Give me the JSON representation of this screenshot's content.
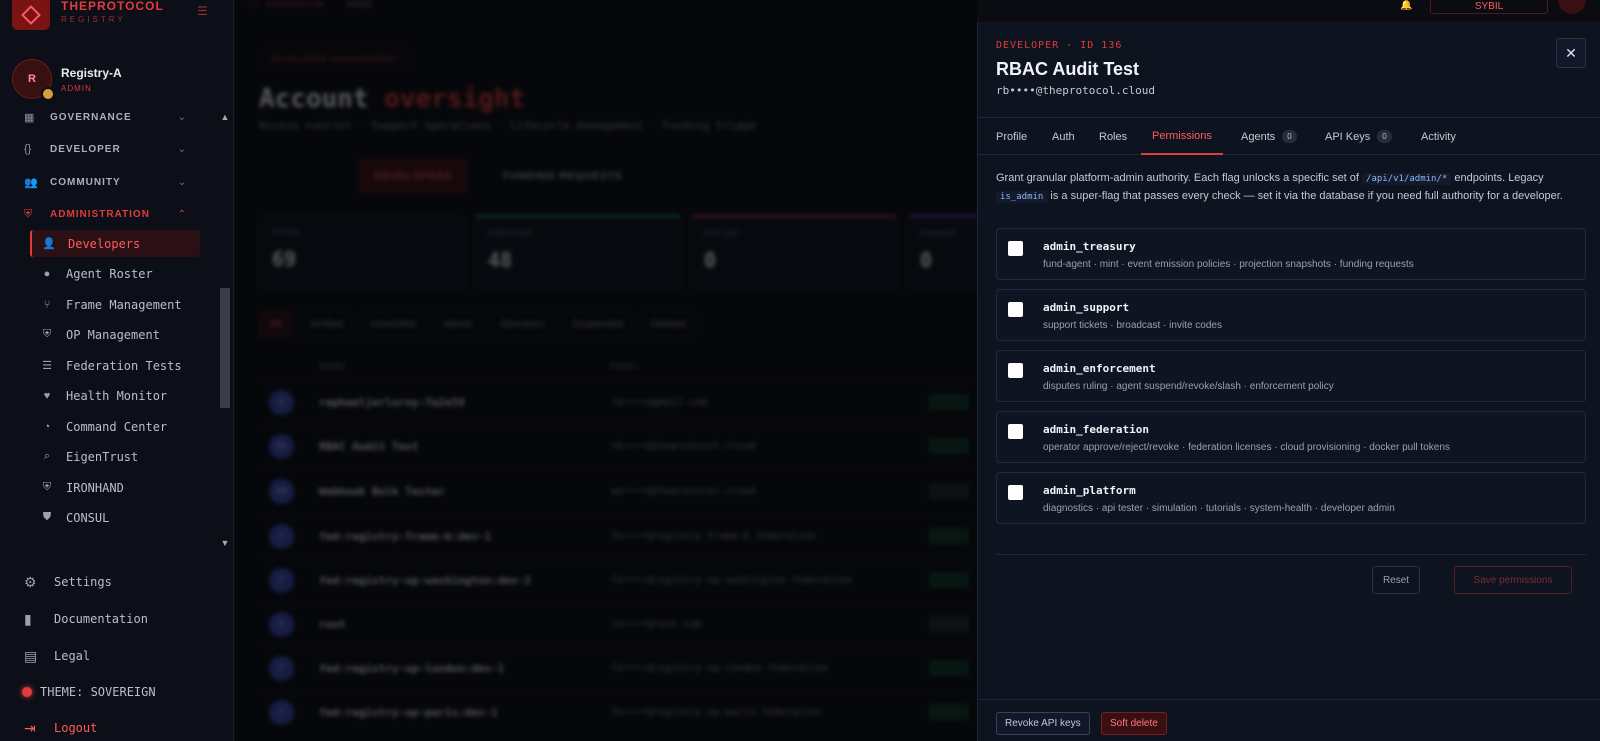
{
  "brand": {
    "name": "THEPROTOCOL",
    "sub": "REGISTRY"
  },
  "user": {
    "name": "Registry-A",
    "role": "ADMIN",
    "initial": "R"
  },
  "nav": {
    "groups": [
      {
        "label": "GOVERNANCE",
        "icon": "grid-icon"
      },
      {
        "label": "DEVELOPER",
        "icon": "code-braces-icon"
      },
      {
        "label": "COMMUNITY",
        "icon": "people-icon"
      },
      {
        "label": "ADMINISTRATION",
        "icon": "shield-icon"
      }
    ],
    "items": [
      {
        "label": "Developers"
      },
      {
        "label": "Agent Roster"
      },
      {
        "label": "Frame Management"
      },
      {
        "label": "OP Management"
      },
      {
        "label": "Federation Tests"
      },
      {
        "label": "Health Monitor"
      },
      {
        "label": "Command Center"
      },
      {
        "label": "EigenTrust"
      },
      {
        "label": "IRONHAND"
      },
      {
        "label": "CONSUL"
      }
    ],
    "footer": {
      "settings": "Settings",
      "documentation": "Documentation",
      "legal": "Legal",
      "theme": "THEME: SOVEREIGN",
      "logout": "Logout"
    }
  },
  "main": {
    "breadcrumb": "// SOVEREIGN",
    "breadcrumb2": "NODE",
    "pill": "DEVELOPER MANAGEMENT",
    "title_a": "Account",
    "title_b": "oversight",
    "subtitle": "Access control · Support operations · Lifecycle management · Funding triage",
    "tabs": [
      "DEVELOPERS",
      "FUNDING REQUESTS"
    ],
    "stats": [
      {
        "label": "TOTAL",
        "value": "69"
      },
      {
        "label": "VERIFIED",
        "value": "48"
      },
      {
        "label": "2FA ON",
        "value": "0"
      },
      {
        "label": "ADMINS",
        "value": "0"
      }
    ],
    "filters": [
      "All",
      "Verified",
      "Unverified",
      "Admin",
      "Operators",
      "Suspended",
      "Deleted"
    ],
    "columns": [
      "NAME",
      "EMAIL"
    ],
    "rows": [
      {
        "initials": "R",
        "name": "raphaeljerlorny-7a2e59",
        "email": "ra••••@gmail.com"
      },
      {
        "initials": "RA",
        "name": "RBAC Audit Test",
        "email": "rb••••@theprotocol.cloud"
      },
      {
        "initials": "WB",
        "name": "Webhook Bulk Tester",
        "email": "we••••@theprotocol.cloud"
      },
      {
        "initials": "F",
        "name": "fed:registry-frame-b:dev-1",
        "email": "fe••••@registry-frame-b.federation"
      },
      {
        "initials": "F",
        "name": "fed:registry-op-washington:dev-2",
        "email": "fe••••@registry-op-washington.federation"
      },
      {
        "initials": "R",
        "name": "root",
        "email": "ro••••@root.com"
      },
      {
        "initials": "F",
        "name": "fed:registry-op-london:dev-1",
        "email": "fe••••@registry-op-london.federation"
      },
      {
        "initials": "F",
        "name": "fed:registry-op-paris:dev-1",
        "email": "fe••••@registry-op-paris.federation"
      }
    ]
  },
  "drawer": {
    "kicker": "DEVELOPER · ID 136",
    "title": "RBAC Audit Test",
    "email": "rb••••@theprotocol.cloud",
    "close": "✕",
    "tabs": [
      {
        "label": "Profile"
      },
      {
        "label": "Auth"
      },
      {
        "label": "Roles"
      },
      {
        "label": "Permissions"
      },
      {
        "label": "Agents",
        "count": "0"
      },
      {
        "label": "API Keys",
        "count": "0"
      },
      {
        "label": "Activity"
      }
    ],
    "desc_1": "Grant granular platform-admin authority. Each flag unlocks a specific set of",
    "desc_code1": "/api/v1/admin/*",
    "desc_2": "endpoints. Legacy",
    "desc_code2": "is_admin",
    "desc_3": "is a super-flag that passes every check — set it via the database if you need full authority for a developer.",
    "permissions": [
      {
        "name": "admin_treasury",
        "desc": "fund-agent · mint · event emission policies · projection snapshots · funding requests"
      },
      {
        "name": "admin_support",
        "desc": "support tickets · broadcast · invite codes"
      },
      {
        "name": "admin_enforcement",
        "desc": "disputes ruling · agent suspend/revoke/slash · enforcement policy"
      },
      {
        "name": "admin_federation",
        "desc": "operator approve/reject/revoke · federation licenses · cloud provisioning · docker pull tokens"
      },
      {
        "name": "admin_platform",
        "desc": "diagnostics · api tester · simulation · tutorials · system-health · developer admin"
      }
    ],
    "reset": "Reset",
    "save": "Save permissions",
    "revoke": "Revoke API keys",
    "soft_delete": "Soft delete"
  },
  "topright": {
    "sybil": "SYBIL"
  },
  "colors": {
    "accent": "#e23b3b",
    "bg": "#0a0c12",
    "panel": "#0e1320"
  }
}
